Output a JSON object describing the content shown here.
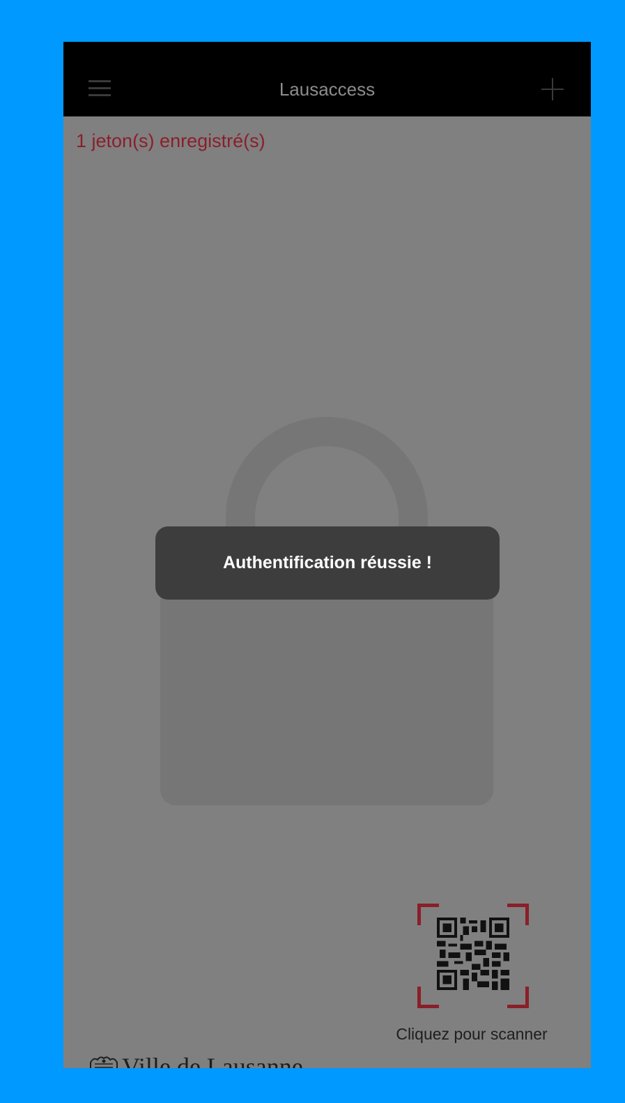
{
  "header": {
    "title": "Lausaccess",
    "menu_icon": "hamburger-menu-icon",
    "add_icon": "plus-icon"
  },
  "status": {
    "token_count": "1 jeton(s) enregistré(s)"
  },
  "toast": {
    "message": "Authentification réussie !"
  },
  "scanner": {
    "icon": "qr-code-icon",
    "label": "Cliquez pour scanner"
  },
  "footer": {
    "brand": "Ville de Lausanne",
    "crest_icon": "lausanne-crest-icon"
  },
  "colors": {
    "background": "#0099ff",
    "navbar": "#000000",
    "overlay": "#808080",
    "accent_red": "#8a1f2a",
    "toast": "#3d3d3d"
  }
}
